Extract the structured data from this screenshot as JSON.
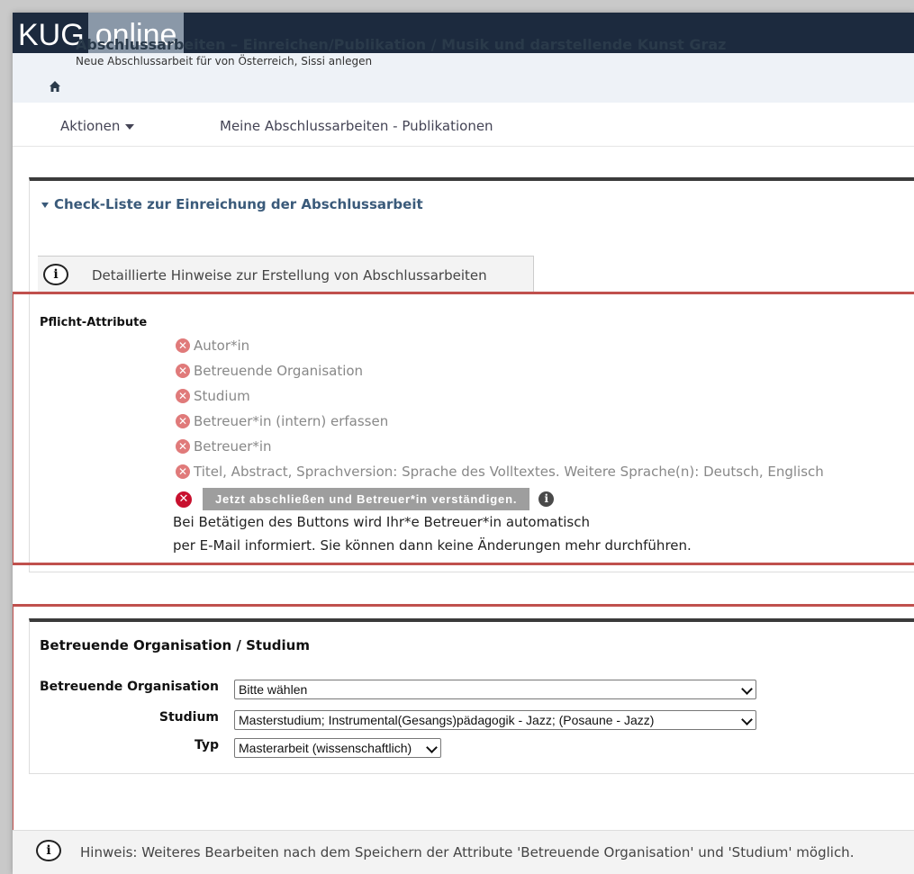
{
  "header": {
    "logo_part1": "KUG",
    "logo_part2": "online",
    "title": "Abschlussarbeiten – Einreichen/Publikation  / Musik und darstellende Kunst Graz",
    "subtitle": "Neue Abschlussarbeit für von Österreich, Sissi anlegen"
  },
  "nav": {
    "actions": "Aktionen",
    "my_theses": "Meine Abschlussarbeiten - Publikationen"
  },
  "checklist": {
    "heading": "Check-Liste zur Einreichung der Abschlussarbeit",
    "hint": "Detaillierte Hinweise zur Erstellung von Abschlussarbeiten",
    "required_label": "Pflicht-Attribute",
    "items": [
      "Autor*in",
      "Betreuende Organisation",
      "Studium",
      "Betreuer*in (intern) erfassen",
      "Betreuer*in",
      "Titel, Abstract, Sprachversion: Sprache des Volltextes. Weitere Sprache(n): Deutsch, Englisch"
    ],
    "finish_button": "Jetzt abschließen und Betreuer*in verständigen.",
    "note_line1": "Bei Betätigen des Buttons wird Ihr*e Betreuer*in automatisch",
    "note_line2": "per E-Mail informiert. Sie können dann keine Änderungen mehr durchführen."
  },
  "org_section": {
    "title": "Betreuende Organisation / Studium",
    "org_label": "Betreuende Organisation",
    "org_value": "Bitte wählen",
    "study_label": "Studium",
    "study_value": "Masterstudium; Instrumental(Gesangs)pädagogik - Jazz; (Posaune - Jazz)",
    "type_label": "Typ",
    "type_value": "Masterarbeit (wissenschaftlich)"
  },
  "bottom_hint": "Hinweis: Weiteres Bearbeiten nach dem Speichern der Attribute 'Betreuende Organisation' und 'Studium' möglich.",
  "colors": {
    "topbar": "#1c2a3e",
    "accent_red": "#c0504d",
    "error_red": "#c8102e"
  }
}
